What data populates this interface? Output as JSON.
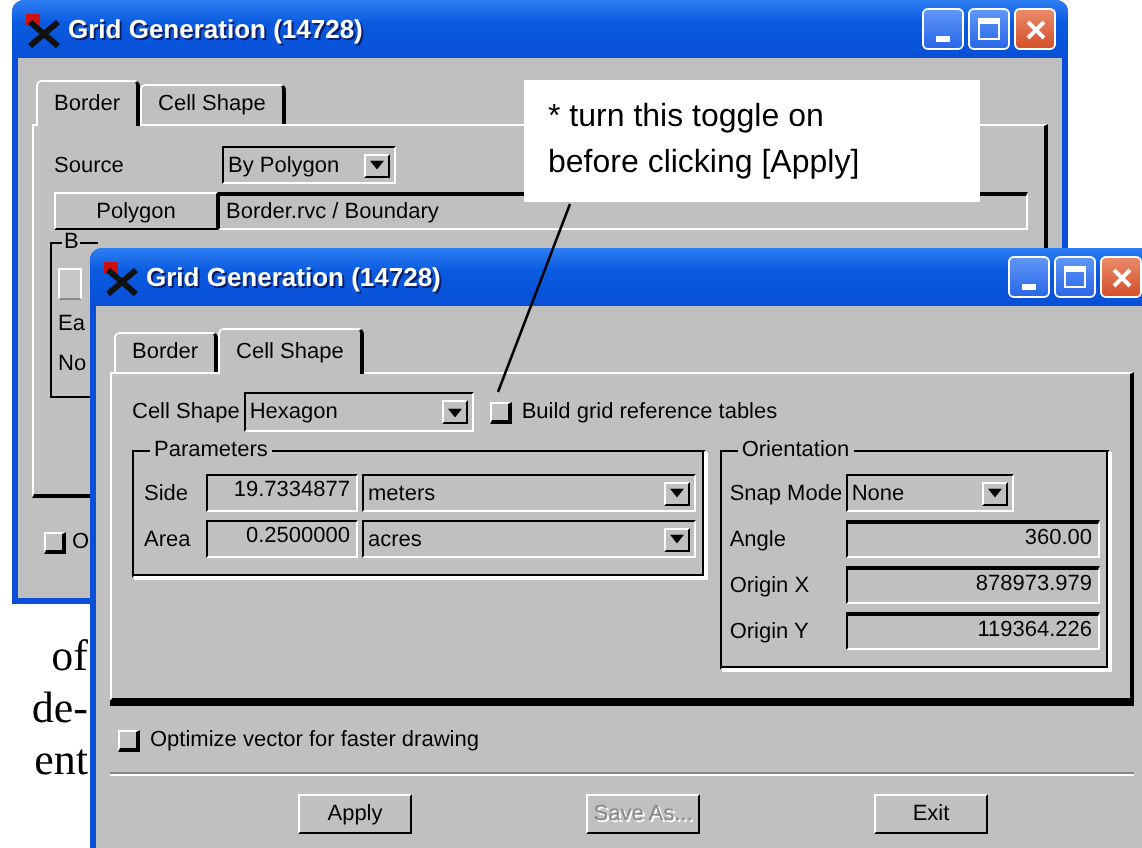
{
  "page_text_fragments": [
    "of",
    "de-",
    "ent"
  ],
  "back_window": {
    "title": "Grid Generation (14728)",
    "tabs": [
      {
        "label": "Border",
        "selected": true
      },
      {
        "label": "Cell Shape",
        "selected": false
      }
    ],
    "source": {
      "label": "Source",
      "value": "By Polygon"
    },
    "polygon": {
      "button": "Polygon",
      "value": "Border.rvc / Boundary"
    },
    "group": {
      "label": "B",
      "rows": [
        "Ea",
        "No"
      ]
    },
    "checkbox": {
      "label": "O",
      "checked": false
    }
  },
  "annotation": {
    "text": "* turn this toggle on\nbefore clicking [Apply]"
  },
  "front_window": {
    "title": "Grid Generation (14728)",
    "tabs": [
      {
        "label": "Border",
        "selected": false
      },
      {
        "label": "Cell Shape",
        "selected": true
      }
    ],
    "cell_shape": {
      "label": "Cell Shape",
      "value": "Hexagon"
    },
    "build_tables": {
      "label": "Build grid reference tables",
      "checked": false
    },
    "parameters": {
      "title": "Parameters",
      "rows": [
        {
          "label": "Side",
          "value": "19.7334877",
          "unit": "meters"
        },
        {
          "label": "Area",
          "value": "0.2500000",
          "unit": "acres"
        }
      ]
    },
    "orientation": {
      "title": "Orientation",
      "snap_mode": {
        "label": "Snap Mode",
        "value": "None"
      },
      "fields": [
        {
          "label": "Angle",
          "value": "360.00"
        },
        {
          "label": "Origin X",
          "value": "878973.979"
        },
        {
          "label": "Origin Y",
          "value": "119364.226"
        }
      ]
    },
    "optimize": {
      "label": "Optimize vector for faster drawing",
      "checked": false
    },
    "buttons": [
      {
        "label": "Apply",
        "disabled": false
      },
      {
        "label": "Save As...",
        "disabled": true
      },
      {
        "label": "Exit",
        "disabled": false
      }
    ]
  }
}
